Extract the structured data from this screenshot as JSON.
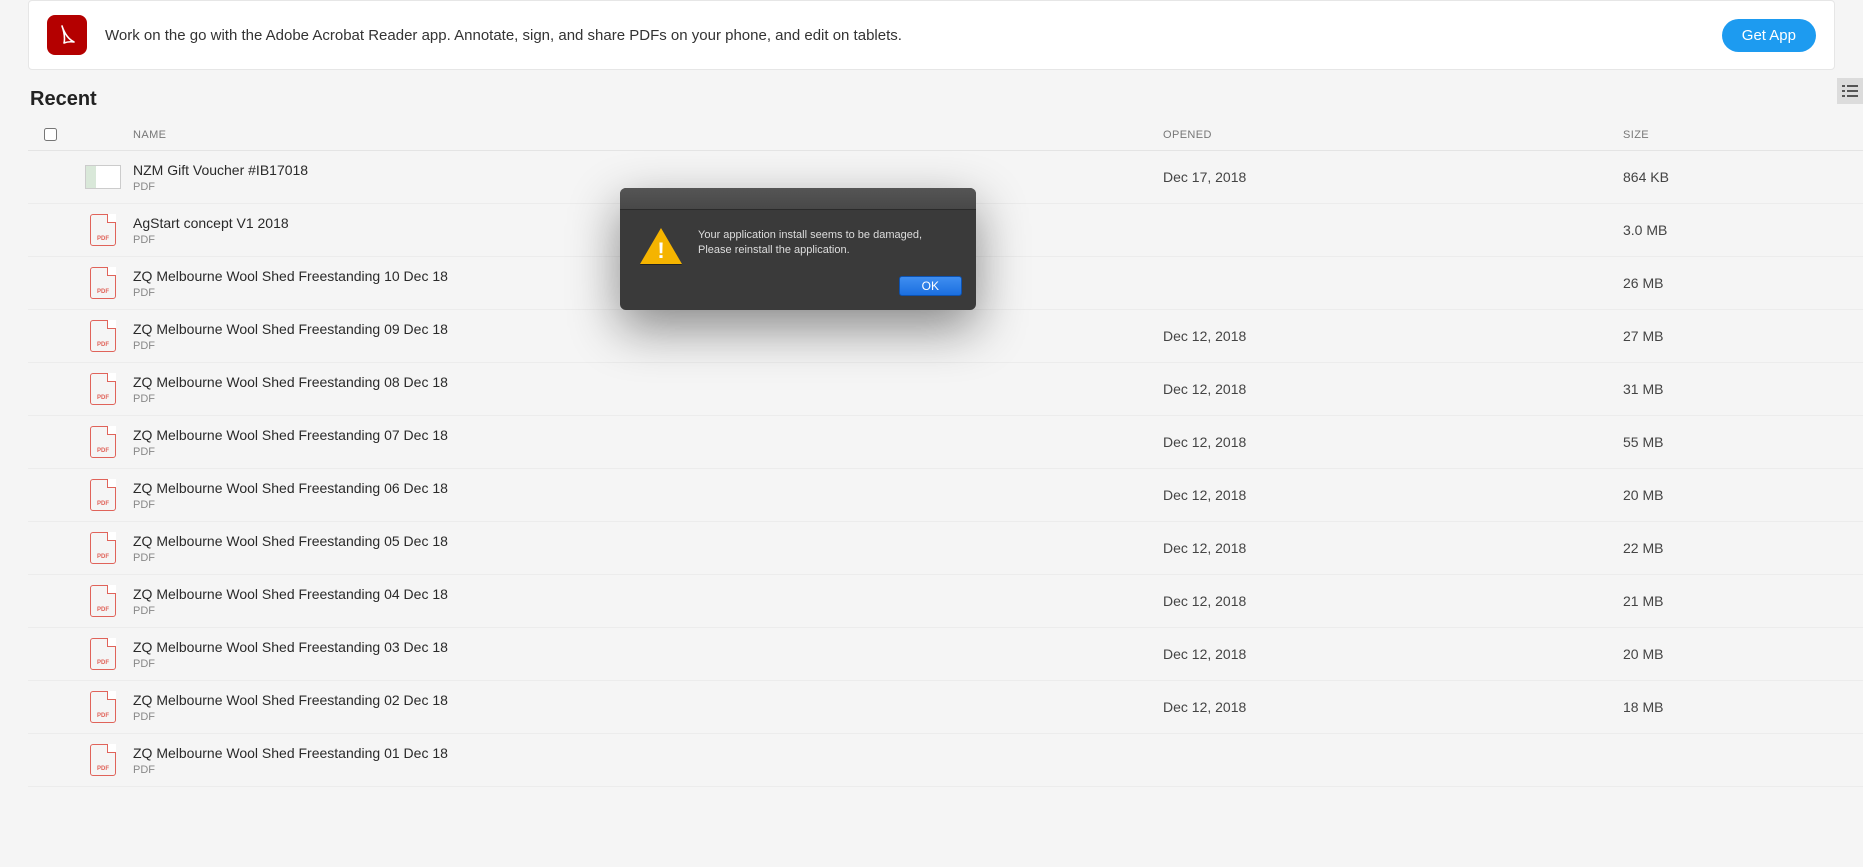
{
  "banner": {
    "text": "Work on the go with the Adobe Acrobat Reader app. Annotate, sign, and share PDFs on your phone, and edit on tablets.",
    "cta": "Get App"
  },
  "section_title": "Recent",
  "columns": {
    "name": "NAME",
    "opened": "OPENED",
    "size": "SIZE"
  },
  "file_type_label": "PDF",
  "files": [
    {
      "name": "NZM Gift Voucher #IB17018",
      "opened": "Dec 17, 2018",
      "size": "864 KB",
      "thumb": "image"
    },
    {
      "name": "AgStart concept V1 2018",
      "opened": "",
      "size": "3.0 MB",
      "thumb": "pdf"
    },
    {
      "name": "ZQ Melbourne Wool Shed Freestanding 10 Dec 18",
      "opened": "",
      "size": "26 MB",
      "thumb": "pdf"
    },
    {
      "name": "ZQ Melbourne Wool Shed Freestanding 09 Dec 18",
      "opened": "Dec 12, 2018",
      "size": "27 MB",
      "thumb": "pdf"
    },
    {
      "name": "ZQ Melbourne Wool Shed Freestanding 08 Dec 18",
      "opened": "Dec 12, 2018",
      "size": "31 MB",
      "thumb": "pdf"
    },
    {
      "name": "ZQ Melbourne Wool Shed Freestanding 07 Dec 18",
      "opened": "Dec 12, 2018",
      "size": "55 MB",
      "thumb": "pdf"
    },
    {
      "name": "ZQ Melbourne Wool Shed Freestanding 06 Dec 18",
      "opened": "Dec 12, 2018",
      "size": "20 MB",
      "thumb": "pdf"
    },
    {
      "name": "ZQ Melbourne Wool Shed Freestanding 05 Dec 18",
      "opened": "Dec 12, 2018",
      "size": "22 MB",
      "thumb": "pdf"
    },
    {
      "name": "ZQ Melbourne Wool Shed Freestanding 04 Dec 18",
      "opened": "Dec 12, 2018",
      "size": "21 MB",
      "thumb": "pdf"
    },
    {
      "name": "ZQ Melbourne Wool Shed Freestanding 03 Dec 18",
      "opened": "Dec 12, 2018",
      "size": "20 MB",
      "thumb": "pdf"
    },
    {
      "name": "ZQ Melbourne Wool Shed Freestanding 02 Dec 18",
      "opened": "Dec 12, 2018",
      "size": "18 MB",
      "thumb": "pdf"
    },
    {
      "name": "ZQ Melbourne Wool Shed Freestanding 01 Dec 18",
      "opened": "",
      "size": "",
      "thumb": "pdf"
    }
  ],
  "dialog": {
    "message": "Your application install seems to be damaged, Please reinstall the application.",
    "ok": "OK"
  }
}
